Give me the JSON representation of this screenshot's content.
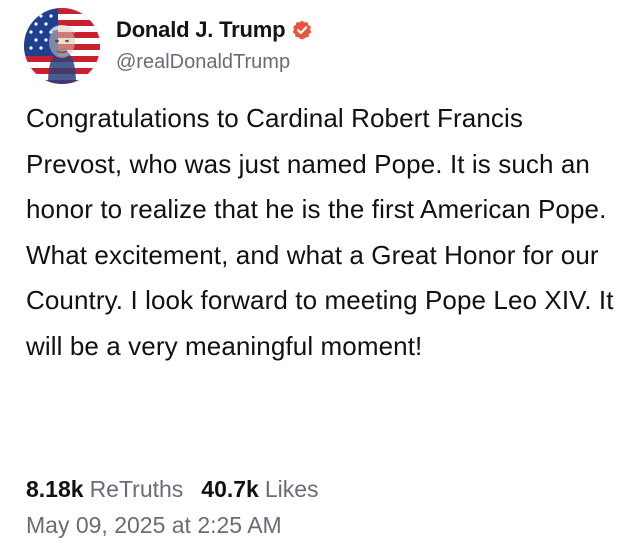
{
  "author": {
    "display_name": "Donald J. Trump",
    "handle": "@realDonaldTrump",
    "verified": true,
    "avatar_icon": "flag-portrait-avatar",
    "verified_icon": "verified-badge-icon"
  },
  "post": {
    "text": "Congratulations to Cardinal Robert Francis Prevost, who was just named Pope. It is such an honor to realize that he is the first American Pope. What excitement, and what a Great Honor for our Country. I look forward to meeting Pope Leo XIV. It will be a very meaningful moment!",
    "retruths_value": "8.18k",
    "retruths_label": "ReTruths",
    "likes_value": "40.7k",
    "likes_label": "Likes",
    "timestamp": "May 09, 2025 at 2:25 AM"
  },
  "colors": {
    "accent": "#e8553e",
    "muted_text": "#6b6b78",
    "text": "#111111"
  }
}
